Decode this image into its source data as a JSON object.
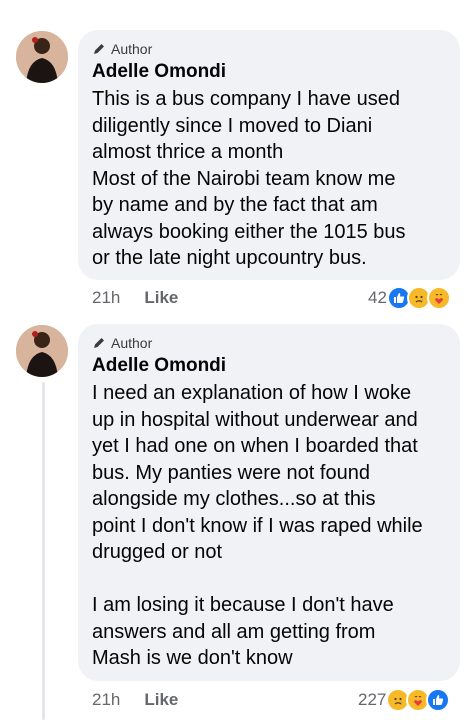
{
  "comments": [
    {
      "badge": "Author",
      "name": "Adelle Omondi",
      "lines": [
        "This is a bus company I have used",
        "diligently since I moved to Diani",
        "almost thrice a month",
        "Most of the Nairobi team know me",
        "by name and by the fact that am",
        "always booking either the 1015 bus",
        "or the late night upcountry bus."
      ],
      "time": "21h",
      "like_label": "Like",
      "reaction_count": "42",
      "reactions": [
        "like-icon",
        "sad-icon",
        "care-icon"
      ]
    },
    {
      "badge": "Author",
      "name": "Adelle Omondi",
      "lines": [
        "I need an explanation of how I woke",
        "up in hospital without underwear and",
        "yet I had one on when I boarded that",
        "bus. My panties were not found",
        "alongside my clothes...so at this",
        "point I don't know if I was raped while",
        "drugged or not",
        "",
        "I am losing it because I don't have",
        "answers and all am getting from",
        "Mash is we don't know"
      ],
      "time": "21h",
      "like_label": "Like",
      "reaction_count": "227",
      "reactions": [
        "sad-icon",
        "care-icon",
        "like-icon"
      ]
    }
  ],
  "colors": {
    "bubble": "#f0f2f5",
    "like_blue": "#1877f2",
    "reaction_yellow": "#f7b928",
    "meta_gray": "#65676b"
  }
}
